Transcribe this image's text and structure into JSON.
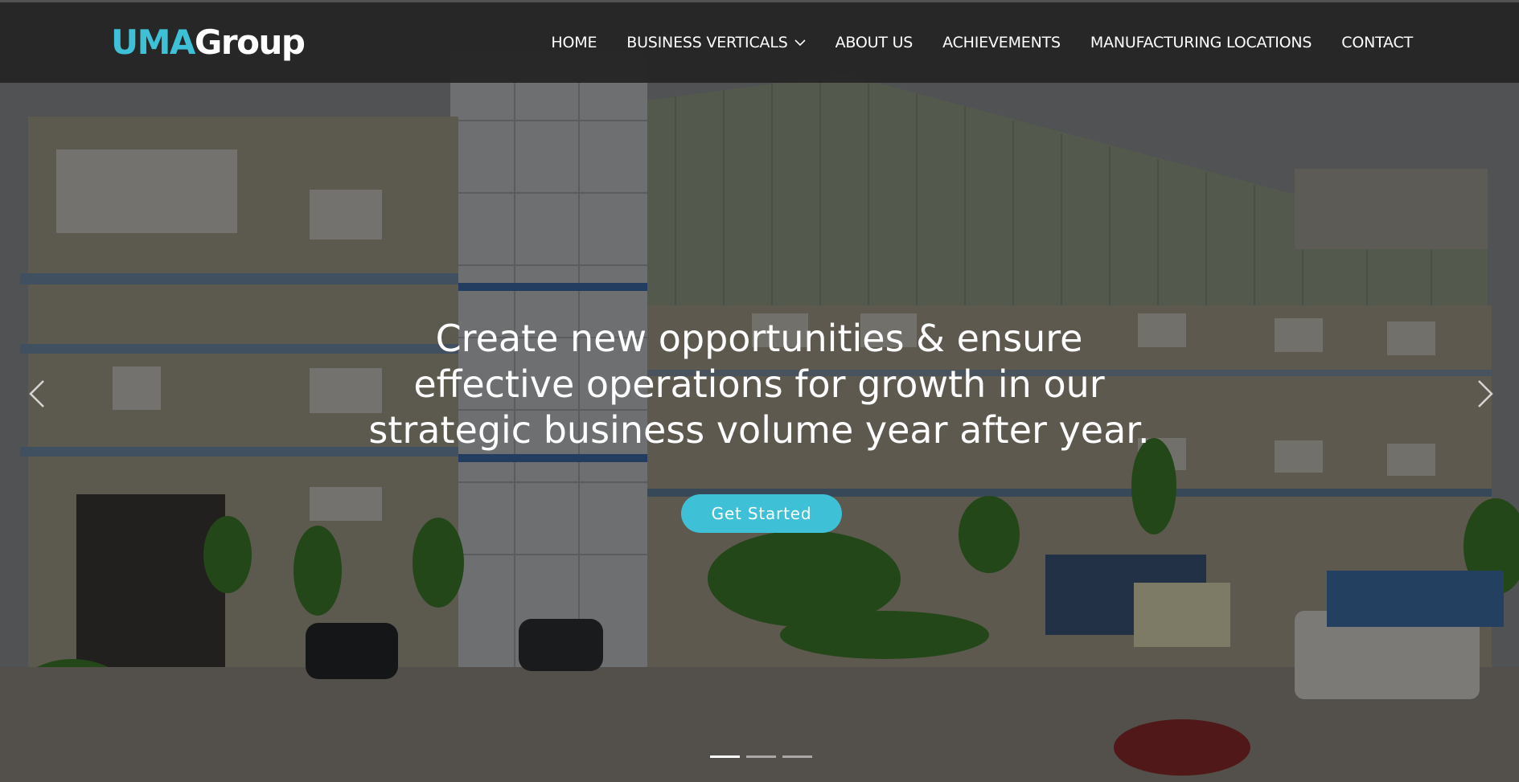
{
  "brand": {
    "logo_part1": "UMA",
    "logo_part2": "Group",
    "accent_color": "#3ec1d7"
  },
  "nav": {
    "items": [
      {
        "label": "HOME"
      },
      {
        "label": "BUSINESS VERTICALS",
        "has_dropdown": true,
        "icon": "chevron-down-icon"
      },
      {
        "label": "ABOUT US"
      },
      {
        "label": "ACHIEVEMENTS"
      },
      {
        "label": "MANUFACTURING LOCATIONS"
      },
      {
        "label": "CONTACT"
      }
    ]
  },
  "hero": {
    "headline_lines": [
      "Create new opportunities & ensure",
      "effective operations for growth in our",
      "strategic business volume year after year."
    ],
    "cta_label": "Get Started",
    "prev_icon": "chevron-left-icon",
    "next_icon": "chevron-right-icon",
    "slide_count": 3,
    "active_slide": 1
  }
}
